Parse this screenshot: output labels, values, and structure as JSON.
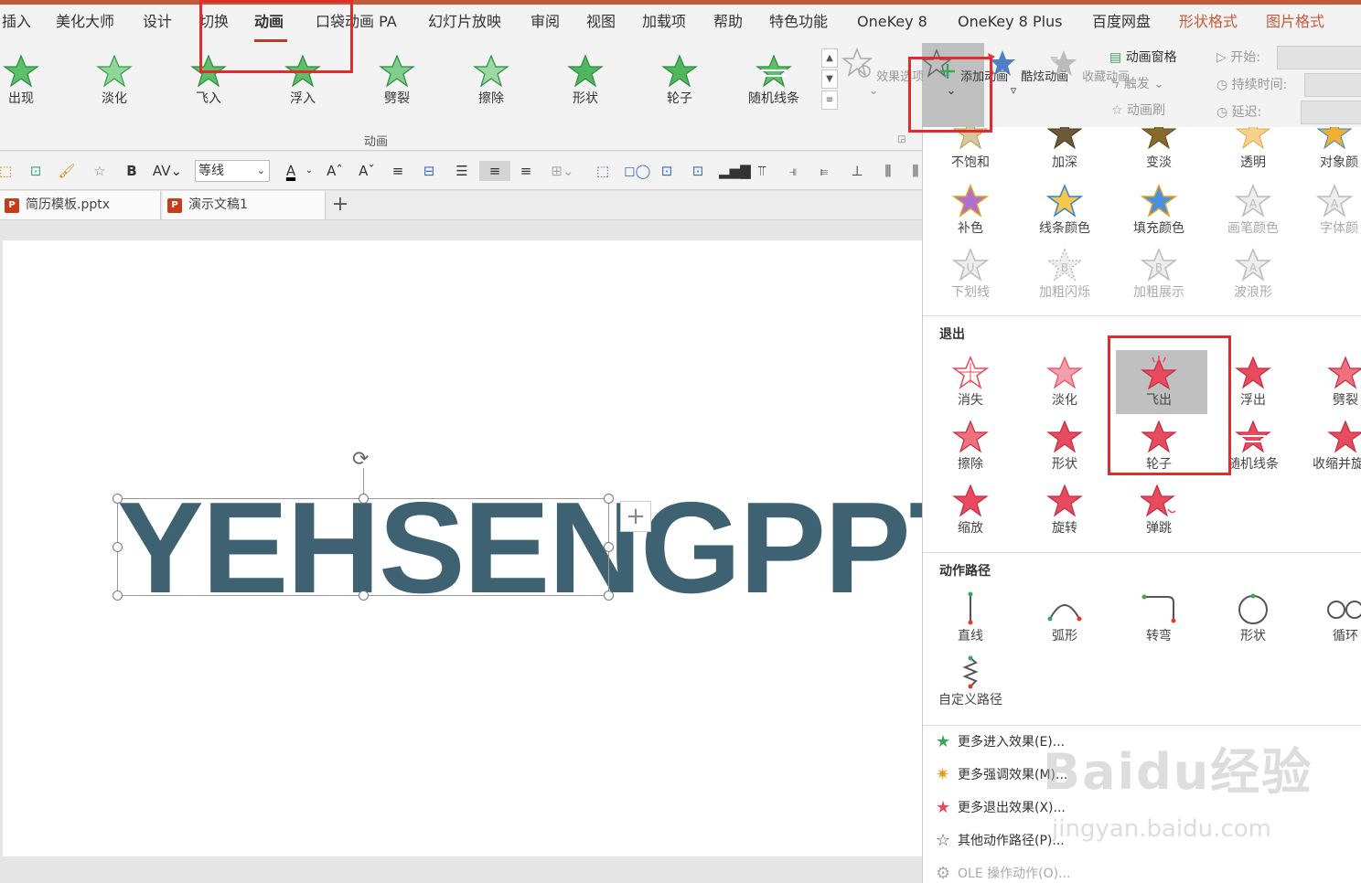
{
  "menu": {
    "items": [
      "插入",
      "美化大师",
      "设计",
      "切换",
      "动画",
      "口袋动画 PA",
      "幻灯片放映",
      "审阅",
      "视图",
      "加载项",
      "帮助",
      "特色功能",
      "OneKey 8",
      "OneKey 8 Plus",
      "百度网盘",
      "形状格式",
      "图片格式"
    ],
    "active": "动画"
  },
  "ribbon": {
    "animations": [
      "出现",
      "淡化",
      "飞入",
      "浮入",
      "劈裂",
      "擦除",
      "形状",
      "轮子",
      "随机线条"
    ],
    "group_label": "动画",
    "effect_options": "效果选项",
    "add_animation": "添加动画",
    "cool_animation": "酷炫动画",
    "favorite_animation": "收藏动画",
    "animation_pane": "动画窗格",
    "trigger": "触发",
    "animation_painter": "动画刷",
    "timing": {
      "start": "开始:",
      "duration": "持续时间:",
      "delay": "延迟:"
    }
  },
  "toolbar": {
    "bold": "B",
    "font": "等线",
    "font_color": "A"
  },
  "doc_tabs": [
    "简历模板.pptx",
    "演示文稿1"
  ],
  "slide": {
    "text": "YEHSENGPPT"
  },
  "panel": {
    "emphasis_row1": [
      "不饱和",
      "加深",
      "变淡",
      "透明",
      "对象颜"
    ],
    "emphasis_row2": [
      "补色",
      "线条颜色",
      "填充颜色",
      "画笔颜色",
      "字体颜"
    ],
    "emphasis_row3": [
      "下划线",
      "加粗闪烁",
      "加粗展示",
      "波浪形"
    ],
    "exit_title": "退出",
    "exit_row1": [
      "消失",
      "淡化",
      "飞出",
      "浮出",
      "劈裂"
    ],
    "exit_row2": [
      "擦除",
      "形状",
      "轮子",
      "随机线条",
      "收缩并旋"
    ],
    "exit_row3": [
      "缩放",
      "旋转",
      "弹跳"
    ],
    "path_title": "动作路径",
    "path_row1": [
      "直线",
      "弧形",
      "转弯",
      "形状",
      "循环"
    ],
    "path_custom": "自定义路径",
    "more": [
      "更多进入效果(E)...",
      "更多强调效果(M)...",
      "更多退出效果(X)...",
      "其他动作路径(P)...",
      "OLE 操作动作(O)..."
    ]
  },
  "watermark": {
    "logo": "Baidu经验",
    "url": "jingyan.baidu.com"
  },
  "colors": {
    "accent": "#c55a3b",
    "green_star": "#4caf50",
    "red_star": "#e84a5f",
    "highlight_box": "#e22b2b"
  }
}
